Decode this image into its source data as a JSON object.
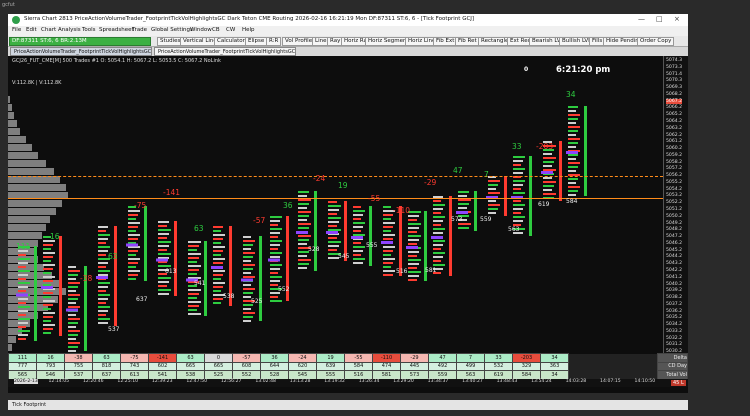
{
  "desktop_label": "gcfut",
  "window": {
    "title": "Sierra Chart 2813 PriceActionVolumeTrader_FootprintTickVolHighlightsGC Dark Teton CME Routing 2026-02-16  16:21:19 Mon DF:87311  ST:6, 6 - [Tick Footprint GCJ]",
    "controls": [
      "—",
      "□",
      "×"
    ]
  },
  "menu": [
    "File",
    "Edit",
    "Chart",
    "Analysis",
    "Tools",
    "Spreadsheet",
    "Trade",
    "Global Settings",
    "Window",
    "CB",
    "CW",
    "Help"
  ],
  "status": {
    "left": "DF:87311  ST:6, 6  BR:2.13M"
  },
  "toolbar": [
    "Studies",
    "Vertical Line",
    "Calculator",
    "Elipse",
    "R:R",
    "Vol Profile",
    "Line",
    "Ray",
    "Horiz Ray",
    "Horiz Segment",
    "Horiz Line",
    "Fib Ext",
    "Fib Ret",
    "Rectangle",
    "Ext Rect",
    "Bearish LVN",
    "Bullish LVN",
    "Fills",
    "Hide Pending",
    "Order Copy"
  ],
  "tabs": [
    "PriceActionVolumeTrader_FootprintTickVolHighlightsGC Dark",
    "PriceActionVolumeTrader_FootprintTickVolHighlightsGC Dark"
  ],
  "chart": {
    "symbol_line": "GCJ26_FUT_CME[M]  500 Trades #1 O: 5054.1 H: 5067.2 L: 5053.5 C: 5067.2 NoLink",
    "volume_line": "V:112.8K | V:112.8K",
    "clock": "6:21:20 pm",
    "counter": "0",
    "price_ticks": [
      "5074.3",
      "5073.3",
      "5071.4",
      "5070.3",
      "5069.3",
      "5068.2",
      "5067.2",
      "5066.2",
      "5065.2",
      "5064.2",
      "5063.2",
      "5062.2",
      "5061.2",
      "5060.2",
      "5059.2",
      "5058.2",
      "5057.2",
      "5056.2",
      "5055.2",
      "5054.2",
      "5053.2",
      "5052.2",
      "5051.2",
      "5050.2",
      "5049.2",
      "5048.2",
      "5047.2",
      "5046.2",
      "5045.2",
      "5044.2",
      "5043.2",
      "5042.2",
      "5041.2",
      "5040.2",
      "5039.2",
      "5038.2",
      "5037.2",
      "5036.2",
      "5035.2",
      "5034.2",
      "5033.2",
      "5032.2",
      "5031.2",
      "5030.2"
    ],
    "current_price": "5067.2",
    "delta_labels": [
      {
        "text": "111",
        "color": "green"
      },
      {
        "text": "16",
        "color": "green"
      },
      {
        "text": "-38",
        "color": "red"
      },
      {
        "text": "63",
        "color": "green"
      },
      {
        "text": "-75",
        "color": "red"
      },
      {
        "text": "-141",
        "color": "red"
      },
      {
        "text": "63",
        "color": "green"
      },
      {
        "text": "-57",
        "color": "red"
      },
      {
        "text": "36",
        "color": "green"
      },
      {
        "text": "-24",
        "color": "red"
      },
      {
        "text": "19",
        "color": "green"
      },
      {
        "text": "-55",
        "color": "red"
      },
      {
        "text": "-110",
        "color": "red"
      },
      {
        "text": "-29",
        "color": "red"
      },
      {
        "text": "47",
        "color": "green"
      },
      {
        "text": "7",
        "color": "green"
      },
      {
        "text": "33",
        "color": "green"
      },
      {
        "text": "-203",
        "color": "red"
      },
      {
        "text": "34",
        "color": "green"
      }
    ],
    "volume_labels": [
      "537",
      "637",
      "613",
      "541",
      "538",
      "525",
      "552",
      "528",
      "545",
      "555",
      "516",
      "581",
      "573",
      "559",
      "563",
      "619",
      "584"
    ]
  },
  "stats": {
    "rows": [
      {
        "name": "Delta",
        "values": [
          "111",
          "16",
          "-38",
          "63",
          "-75",
          "-141",
          "63",
          "0",
          "-57",
          "36",
          "-24",
          "19",
          "-55",
          "-110",
          "-29",
          "47",
          "7",
          "33",
          "-203",
          "34"
        ]
      },
      {
        "name": "CD Day",
        "values": [
          "777",
          "793",
          "755",
          "818",
          "743",
          "602",
          "665",
          "665",
          "608",
          "644",
          "620",
          "639",
          "584",
          "474",
          "445",
          "492",
          "499",
          "532",
          "329",
          "363"
        ]
      },
      {
        "name": "Total Vol",
        "values": [
          "565",
          "546",
          "537",
          "637",
          "613",
          "541",
          "538",
          "525",
          "552",
          "528",
          "545",
          "555",
          "516",
          "581",
          "573",
          "559",
          "563",
          "619",
          "584",
          "34"
        ]
      }
    ]
  },
  "time_axis": [
    "2026-2-13",
    "12:14:05",
    "12:20:46",
    "12:25:10",
    "12:39:23",
    "12:47:50",
    "12:56:27",
    "13:02:48",
    "13:13:28",
    "13:19:32",
    "13:26:34",
    "13:29:20",
    "13:34:37",
    "13:40:27",
    "13:48:43",
    "13:54:24",
    "14:03:28",
    "14:07:15",
    "14:10:50"
  ],
  "volume_readout": "45 L",
  "bottom_tab": "Tick Footprint",
  "colors": {
    "buy": "#2ecc40",
    "sell": "#ff3b30",
    "poc": "#8e44ff",
    "hline": "#ff8c1a",
    "profile": "#7f7f7f"
  }
}
